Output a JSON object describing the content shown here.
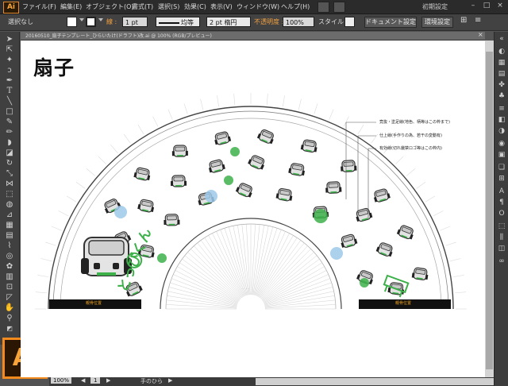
{
  "app": {
    "logo": "Ai",
    "badge": "Ai",
    "workspace": "初期設定"
  },
  "menu": [
    "ファイル(F)",
    "編集(E)",
    "オブジェクト(O)",
    "書式(T)",
    "選択(S)",
    "効果(C)",
    "表示(V)",
    "ウィンドウ(W)",
    "ヘルプ(H)"
  ],
  "window_controls": [
    "–",
    "□",
    "×"
  ],
  "control_bar": {
    "selection": "選択なし",
    "stroke_label": "線 :",
    "stroke_weight": "1 pt",
    "profile": "均等",
    "brush": "2 pt 楕円",
    "opacity_label": "不透明度 :",
    "opacity": "100%",
    "style_label": "スタイル :",
    "doc_settings": "ドキュメント設定",
    "preferences": "環境設定"
  },
  "document": {
    "tab_title": "20160510_扇子テンプレート_ひらいたけ(ドラフト)改.ai @ 100% (RGB/プレビュー)",
    "title": "扇子",
    "annotations": [
      "竟抜・塗足線(地色、柄等はこの枠まで)",
      "仕上線(手作りの為、若干の変動有)",
      "有効線(切れ厳禁ロゴ等はこの枠内)"
    ],
    "rib_labels": [
      "親骨位置",
      "親骨位置"
    ],
    "brand_text": "とっぴくん"
  },
  "status": {
    "zoom": "100%",
    "page": "1",
    "tool_name": "手のひら"
  },
  "colors": {
    "accent": "#f28a1e",
    "green": "#3db04a",
    "warning": "#e8a020",
    "bg": "#535353"
  }
}
